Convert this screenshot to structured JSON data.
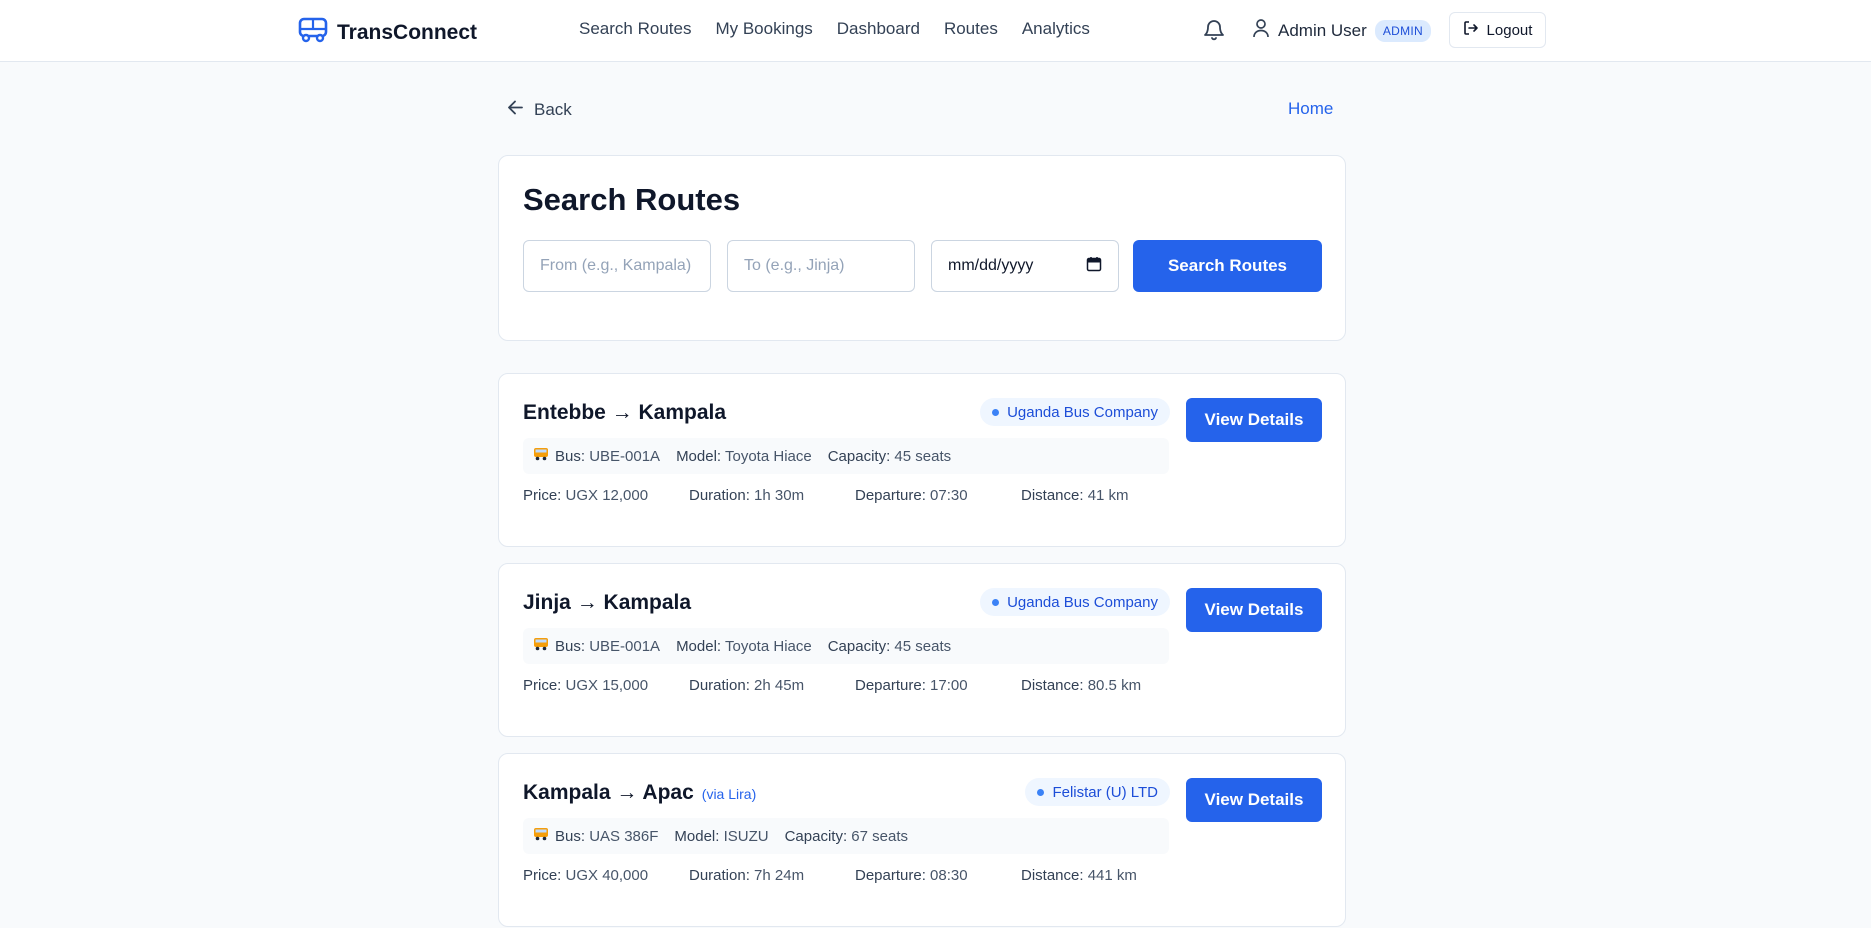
{
  "header": {
    "brand": "TransConnect",
    "nav": [
      "Search Routes",
      "My Bookings",
      "Dashboard",
      "Routes",
      "Analytics"
    ],
    "user_name": "Admin User",
    "role_badge": "ADMIN",
    "logout_label": "Logout"
  },
  "page": {
    "back_label": "Back",
    "home_label": "Home"
  },
  "search": {
    "title": "Search Routes",
    "from_placeholder": "From (e.g., Kampala)",
    "to_placeholder": "To (e.g., Jinja)",
    "date_placeholder": "mm/dd/yyyy",
    "button_label": "Search Routes"
  },
  "labels": {
    "bus": "Bus:",
    "model": "Model:",
    "capacity": "Capacity:",
    "price": "Price:",
    "duration": "Duration:",
    "departure": "Departure:",
    "distance": "Distance:",
    "view_details": "View Details"
  },
  "routes": [
    {
      "title": "Entebbe → Kampala",
      "via": "",
      "company": "Uganda Bus Company",
      "bus": "UBE-001A",
      "model": "Toyota Hiace",
      "capacity": "45 seats",
      "price": "UGX 12,000",
      "duration": "1h 30m",
      "departure": "07:30",
      "distance": "41 km"
    },
    {
      "title": "Jinja → Kampala",
      "via": "",
      "company": "Uganda Bus Company",
      "bus": "UBE-001A",
      "model": "Toyota Hiace",
      "capacity": "45 seats",
      "price": "UGX 15,000",
      "duration": "2h 45m",
      "departure": "17:00",
      "distance": "80.5 km"
    },
    {
      "title": "Kampala → Apac",
      "via": "(via Lira)",
      "company": "Felistar (U) LTD",
      "bus": "UAS 386F",
      "model": "ISUZU",
      "capacity": "67 seats",
      "price": "UGX 40,000",
      "duration": "7h 24m",
      "departure": "08:30",
      "distance": "441 km"
    }
  ],
  "colors": {
    "accent": "#2563eb",
    "badge_bg": "#eff6ff",
    "page_bg": "#f8fafc"
  },
  "icons": [
    "bus-logo-icon",
    "bell-icon",
    "user-icon",
    "logout-icon",
    "arrow-left-icon",
    "calendar-icon",
    "bus-emoji-icon"
  ]
}
